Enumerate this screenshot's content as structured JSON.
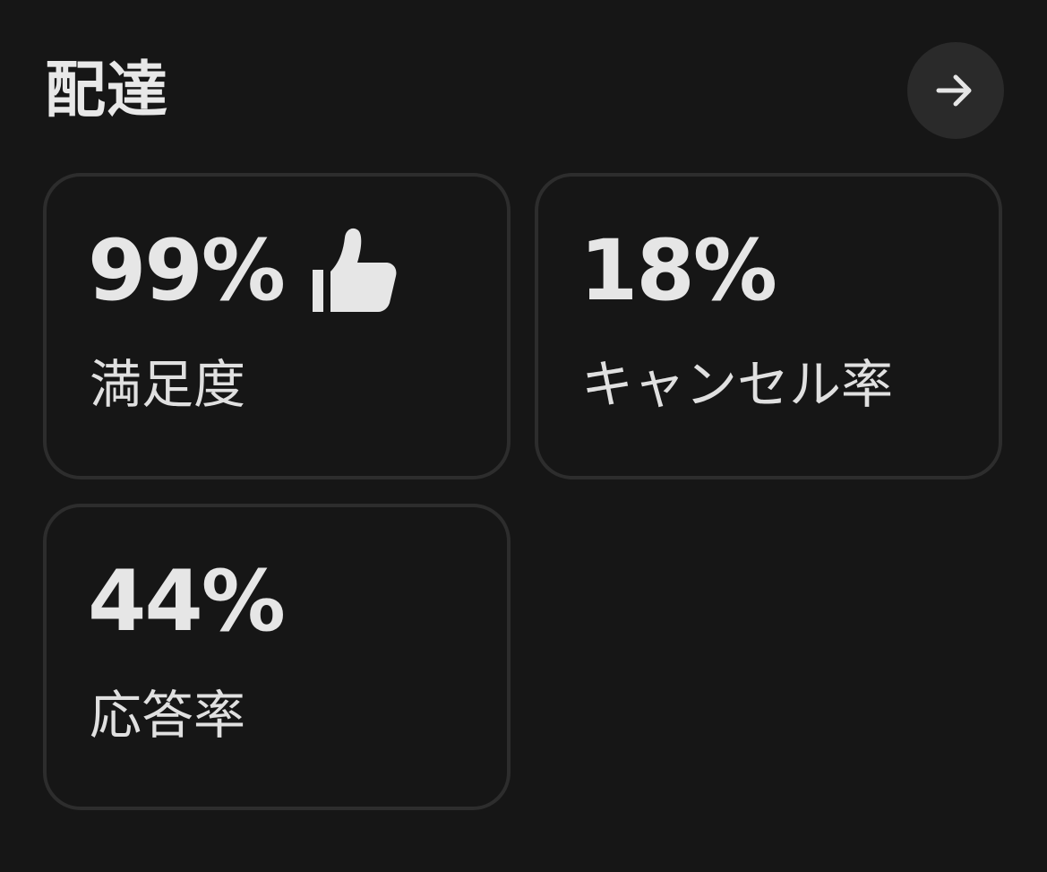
{
  "header": {
    "title": "配達",
    "action_icon": "arrow-right-icon"
  },
  "metrics": [
    {
      "value": "99%",
      "label": "満足度",
      "icon": "thumbs-up-icon"
    },
    {
      "value": "18%",
      "label": "キャンセル率"
    },
    {
      "value": "44%",
      "label": "応答率"
    }
  ],
  "colors": {
    "background": "#161616",
    "card_border": "#2d2d2d",
    "button_background": "#2a2a2a",
    "text": "#e6e6e6"
  }
}
